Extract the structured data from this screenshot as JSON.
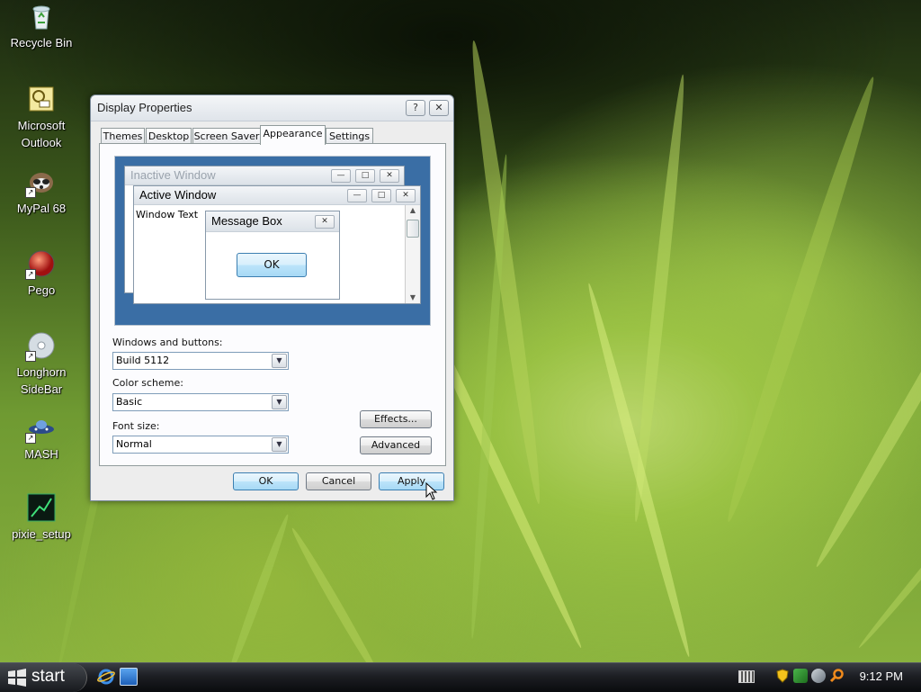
{
  "desktop": {
    "icons": [
      {
        "label": "Recycle Bin"
      },
      {
        "label": "Microsoft Outlook"
      },
      {
        "label": "MyPal 68"
      },
      {
        "label": "Pego"
      },
      {
        "label": "Longhorn SideBar"
      },
      {
        "label": "MASH"
      },
      {
        "label": "pixie_setup"
      }
    ]
  },
  "dialog": {
    "title": "Display Properties",
    "help_glyph": "?",
    "close_glyph": "✕",
    "tabs": [
      {
        "label": "Themes",
        "active": false
      },
      {
        "label": "Desktop",
        "active": false
      },
      {
        "label": "Screen Saver",
        "active": false
      },
      {
        "label": "Appearance",
        "active": true
      },
      {
        "label": "Settings",
        "active": false
      }
    ],
    "preview": {
      "inactive_title": "Inactive Window",
      "active_title": "Active Window",
      "window_text": "Window Text",
      "message_title": "Message Box",
      "message_ok": "OK"
    },
    "windows_buttons_label": "Windows and buttons:",
    "windows_buttons_value": "Build 5112",
    "color_scheme_label": "Color scheme:",
    "color_scheme_value": "Basic",
    "font_size_label": "Font size:",
    "font_size_value": "Normal",
    "effects_label": "Effects...",
    "advanced_label": "Advanced",
    "ok_label": "OK",
    "cancel_label": "Cancel",
    "apply_label": "Apply"
  },
  "taskbar": {
    "start_label": "start",
    "clock": "9:12 PM"
  },
  "colors": {
    "preview_desktop": "#3a6ea5",
    "taskbar": "#1c1e23",
    "button_blue": "#bce4fa"
  }
}
